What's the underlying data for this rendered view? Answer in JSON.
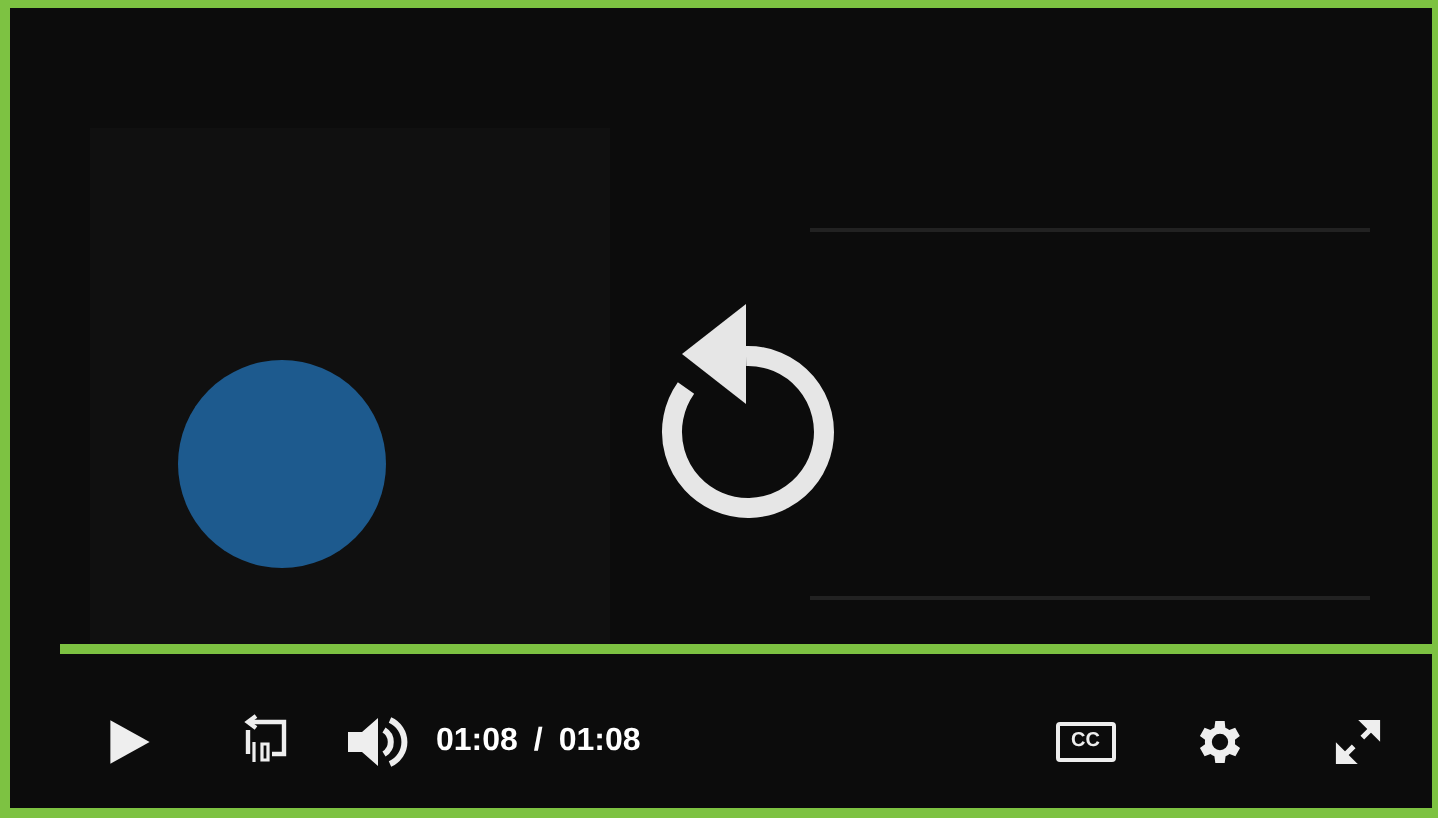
{
  "player": {
    "progress": {
      "level": 1
    },
    "time": {
      "current": "01:08",
      "separator": "/",
      "duration": "01:08"
    },
    "captions": {
      "label": "CC"
    }
  }
}
